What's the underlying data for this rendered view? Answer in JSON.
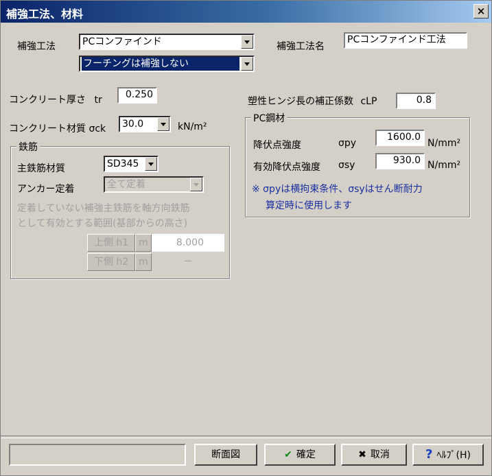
{
  "window": {
    "title": "補強工法、材料",
    "close_glyph": "×"
  },
  "method": {
    "label": "補強工法",
    "combo_value": "PCコンファインド",
    "sub_combo_value": "フーチングは補強しない",
    "name_label": "補強工法名",
    "name_value": "PCコンファインド工法"
  },
  "concrete": {
    "thickness_label": "コンクリート厚さ",
    "thickness_symbol": "tr",
    "thickness_value": "0.250",
    "material_label": "コンクリート材質 σck",
    "material_value": "30.0",
    "material_unit": "kN/m²"
  },
  "plastic_hinge": {
    "label": "塑性ヒンジ長の補正係数",
    "symbol": "cLP",
    "value": "0.8"
  },
  "rebar": {
    "group_title": "鉄筋",
    "main_label": "主鉄筋材質",
    "main_value": "SD345",
    "anchor_label": "アンカー定着",
    "anchor_value": "全て定着",
    "note_line1": "定着していない補強主鉄筋を軸方向鉄筋",
    "note_line2": "として有効とする範囲(基部からの高さ)",
    "rows": [
      {
        "name": "上側 h1",
        "unit": "m",
        "value": "8.000"
      },
      {
        "name": "下側 h2",
        "unit": "m",
        "value": "－"
      }
    ]
  },
  "pc_steel": {
    "group_title": "PC鋼材",
    "yield_label": "降伏点強度",
    "yield_symbol": "σpy",
    "yield_value": "1600.0",
    "yield_unit": "N/mm²",
    "eff_label": "有効降伏点強度",
    "eff_symbol": "σsy",
    "eff_value": "930.0",
    "eff_unit": "N/mm²",
    "note_line1": "※ σpyは横拘束条件、σsyはせん断耐力",
    "note_line2": "算定時に使用します"
  },
  "footer": {
    "section_button": "断面図",
    "ok_button": "確定",
    "cancel_button": "取消",
    "help_button": "ﾍﾙﾌﾟ(H)"
  },
  "icons": {
    "ok": "check-icon",
    "cancel": "x-icon",
    "help": "question-icon"
  }
}
